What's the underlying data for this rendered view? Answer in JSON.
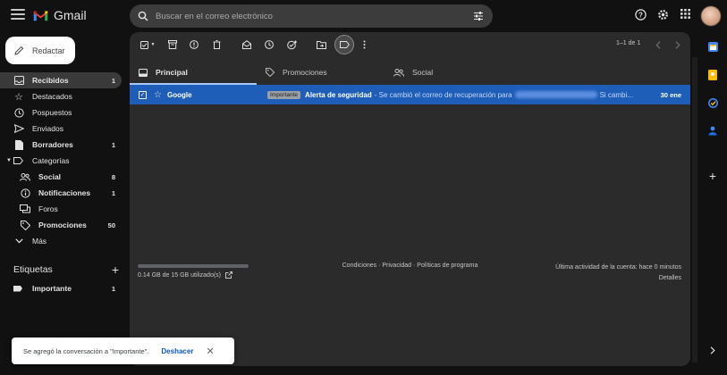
{
  "app": {
    "name": "Gmail"
  },
  "search": {
    "placeholder": "Buscar en el correo electrónico"
  },
  "compose": {
    "label": "Redactar"
  },
  "sidebar": {
    "items": [
      {
        "label": "Recibidos",
        "count": "1",
        "bold": true
      },
      {
        "label": "Destacados",
        "count": ""
      },
      {
        "label": "Pospuestos",
        "count": ""
      },
      {
        "label": "Enviados",
        "count": ""
      },
      {
        "label": "Borradores",
        "count": "1",
        "bold": true
      },
      {
        "label": "Categorías",
        "count": ""
      },
      {
        "label": "Social",
        "count": "8",
        "bold": true
      },
      {
        "label": "Notificaciones",
        "count": "1",
        "bold": true
      },
      {
        "label": "Foros",
        "count": ""
      },
      {
        "label": "Promociones",
        "count": "50",
        "bold": true
      },
      {
        "label": "Más",
        "count": ""
      }
    ]
  },
  "labels": {
    "heading": "Etiquetas",
    "items": [
      {
        "label": "Importante",
        "count": "1"
      }
    ]
  },
  "toolbar": {
    "pager": "1–1 de 1"
  },
  "tabs": [
    {
      "label": "Principal"
    },
    {
      "label": "Promociones"
    },
    {
      "label": "Social"
    }
  ],
  "emails": [
    {
      "sender": "Google",
      "badge": "Importante",
      "subject": "Alerta de seguridad",
      "snippet_start": "- Se cambió el correo de recuperación para",
      "snippet_end": "Si cambi...",
      "date": "30 ene"
    }
  ],
  "footer": {
    "storage": "0.14 GB de 15 GB utilizado(s)",
    "storage_used_fraction": 0.0093,
    "terms": "Condiciones · Privacidad · Políticas de programa",
    "activity": "Última actividad de la cuenta: hace 0 minutos",
    "details": "Detalles"
  },
  "toast": {
    "message": "Se agregó la conversación a \"Importante\".",
    "action": "Deshacer"
  },
  "colors": {
    "selected_row": "#1e5db8",
    "accent_tab": "#a8c7fa"
  }
}
